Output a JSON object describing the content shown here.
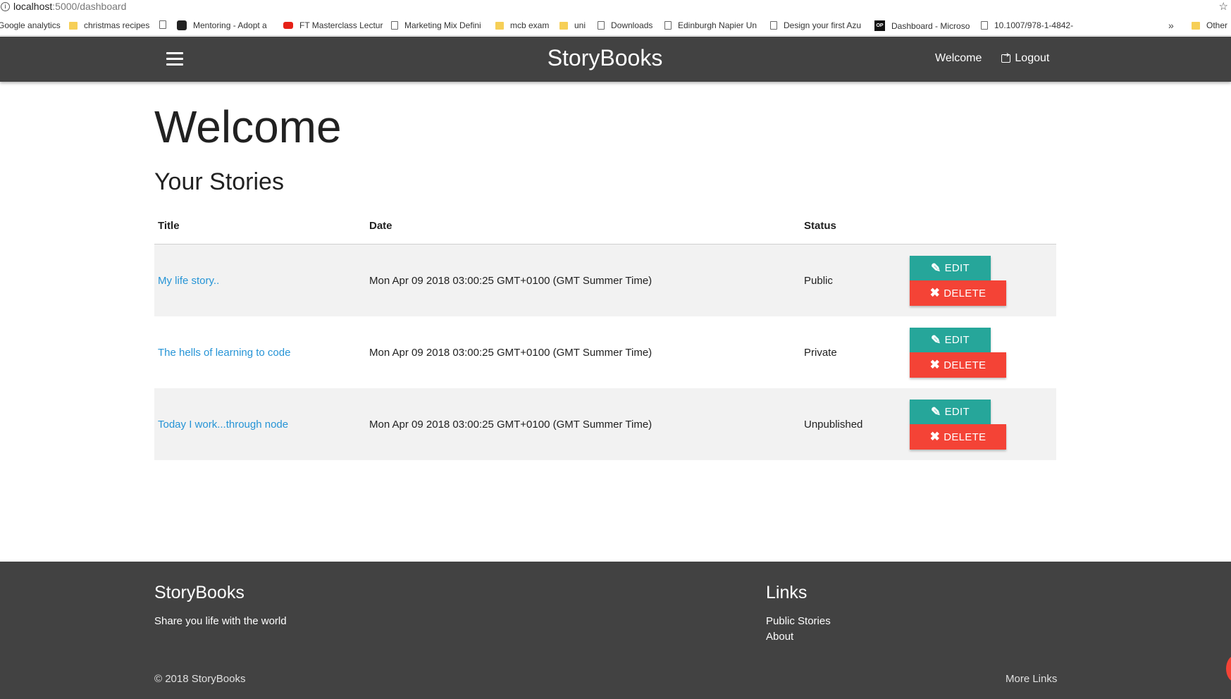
{
  "browser": {
    "url_host": "localhost",
    "url_path": ":5000/dashboard",
    "bookmarks": [
      {
        "label": "Google analytics",
        "icon": "page-icon"
      },
      {
        "label": "christmas recipes",
        "icon": "folder-icon"
      },
      {
        "label": "Mentoring - Adopt a",
        "icon": "instagram-icon"
      },
      {
        "label": "FT Masterclass Lectur",
        "icon": "youtube-icon"
      },
      {
        "label": "Marketing Mix Defini",
        "icon": "page-icon"
      },
      {
        "label": "mcb exam",
        "icon": "folder-icon"
      },
      {
        "label": "uni",
        "icon": "folder-icon"
      },
      {
        "label": "Downloads",
        "icon": "page-icon"
      },
      {
        "label": "Edinburgh Napier Un",
        "icon": "page-icon"
      },
      {
        "label": "Design your first Azu",
        "icon": "page-icon"
      },
      {
        "label": "Dashboard - Microso",
        "icon": "op-icon"
      },
      {
        "label": "10.1007/978-1-4842-",
        "icon": "page-icon"
      },
      {
        "label": "Other",
        "icon": "folder-icon"
      }
    ],
    "more_label": "»",
    "op_icon_text": "OP"
  },
  "navbar": {
    "brand": "StoryBooks",
    "welcome": "Welcome",
    "logout": "Logout"
  },
  "main": {
    "title": "Welcome",
    "section_title": "Your Stories",
    "table": {
      "headers": [
        "Title",
        "Date",
        "Status"
      ],
      "rows": [
        {
          "title": "My life story..",
          "date": "Mon Apr 09 2018 03:00:25 GMT+0100 (GMT Summer Time)",
          "status": "Public"
        },
        {
          "title": "The hells of learning to code",
          "date": "Mon Apr 09 2018 03:00:25 GMT+0100 (GMT Summer Time)",
          "status": "Private"
        },
        {
          "title": "Today I work...through node",
          "date": "Mon Apr 09 2018 03:00:25 GMT+0100 (GMT Summer Time)",
          "status": "Unpublished"
        }
      ],
      "edit_label": "EDIT",
      "delete_label": "DELETE"
    }
  },
  "footer": {
    "brand": "StoryBooks",
    "tagline": "Share you life with the world",
    "links_title": "Links",
    "links": [
      "Public Stories",
      "About"
    ],
    "copyright": "© 2018 StoryBooks",
    "more_links": "More Links"
  },
  "colors": {
    "navbar": "#424242",
    "edit": "#26a69a",
    "delete": "#f44336",
    "link": "#2694d6"
  }
}
